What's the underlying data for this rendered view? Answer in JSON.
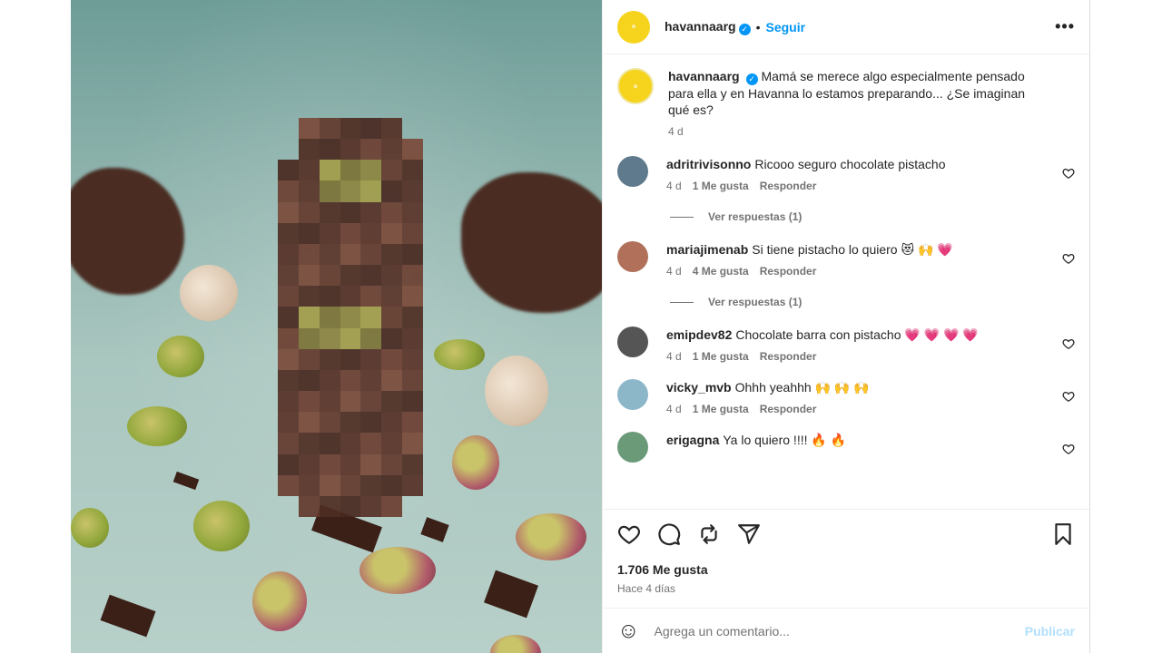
{
  "post": {
    "username": "havannaarg",
    "follow_label": "Seguir",
    "dot": "•",
    "more_label": "•••",
    "verified_mark": "✓",
    "caption": "Mamá se merece algo especialmente pensado para ella y en Havanna lo estamos preparando... ¿Se imaginan qué es?",
    "caption_age": "4 d"
  },
  "comments": [
    {
      "user": "adritrivisonno",
      "text": "Ricooo seguro chocolate pistacho",
      "age": "4 d",
      "likes": "1 Me gusta",
      "reply": "Responder",
      "replies": "Ver respuestas (1)",
      "avatar_color": "#5e7a8c"
    },
    {
      "user": "mariajimenab",
      "text": "Si tiene pistacho lo quiero 😻 🙌 💗",
      "age": "4 d",
      "likes": "4 Me gusta",
      "reply": "Responder",
      "replies": "Ver respuestas (1)",
      "avatar_color": "#b0705a"
    },
    {
      "user": "emipdev82",
      "text": "Chocolate barra con pistacho 💗 💗 💗 💗",
      "age": "4 d",
      "likes": "1 Me gusta",
      "reply": "Responder",
      "avatar_color": "#555555"
    },
    {
      "user": "vicky_mvb",
      "text": "Ohhh yeahhh 🙌 🙌 🙌",
      "age": "4 d",
      "likes": "1 Me gusta",
      "reply": "Responder",
      "avatar_color": "#8bb7c9"
    },
    {
      "user": "erigagna",
      "text": "Ya lo quiero !!!! 🔥 🔥",
      "avatar_color": "#6a9a78"
    }
  ],
  "footer": {
    "likes_count": "1.706 Me gusta",
    "posted": "Hace 4 días",
    "comment_placeholder": "Agrega un comentario...",
    "publish_label": "Publicar",
    "emoji_icon": "☺"
  },
  "colors": {
    "accent": "#0095f6",
    "brand_yellow": "#f6d31c"
  }
}
